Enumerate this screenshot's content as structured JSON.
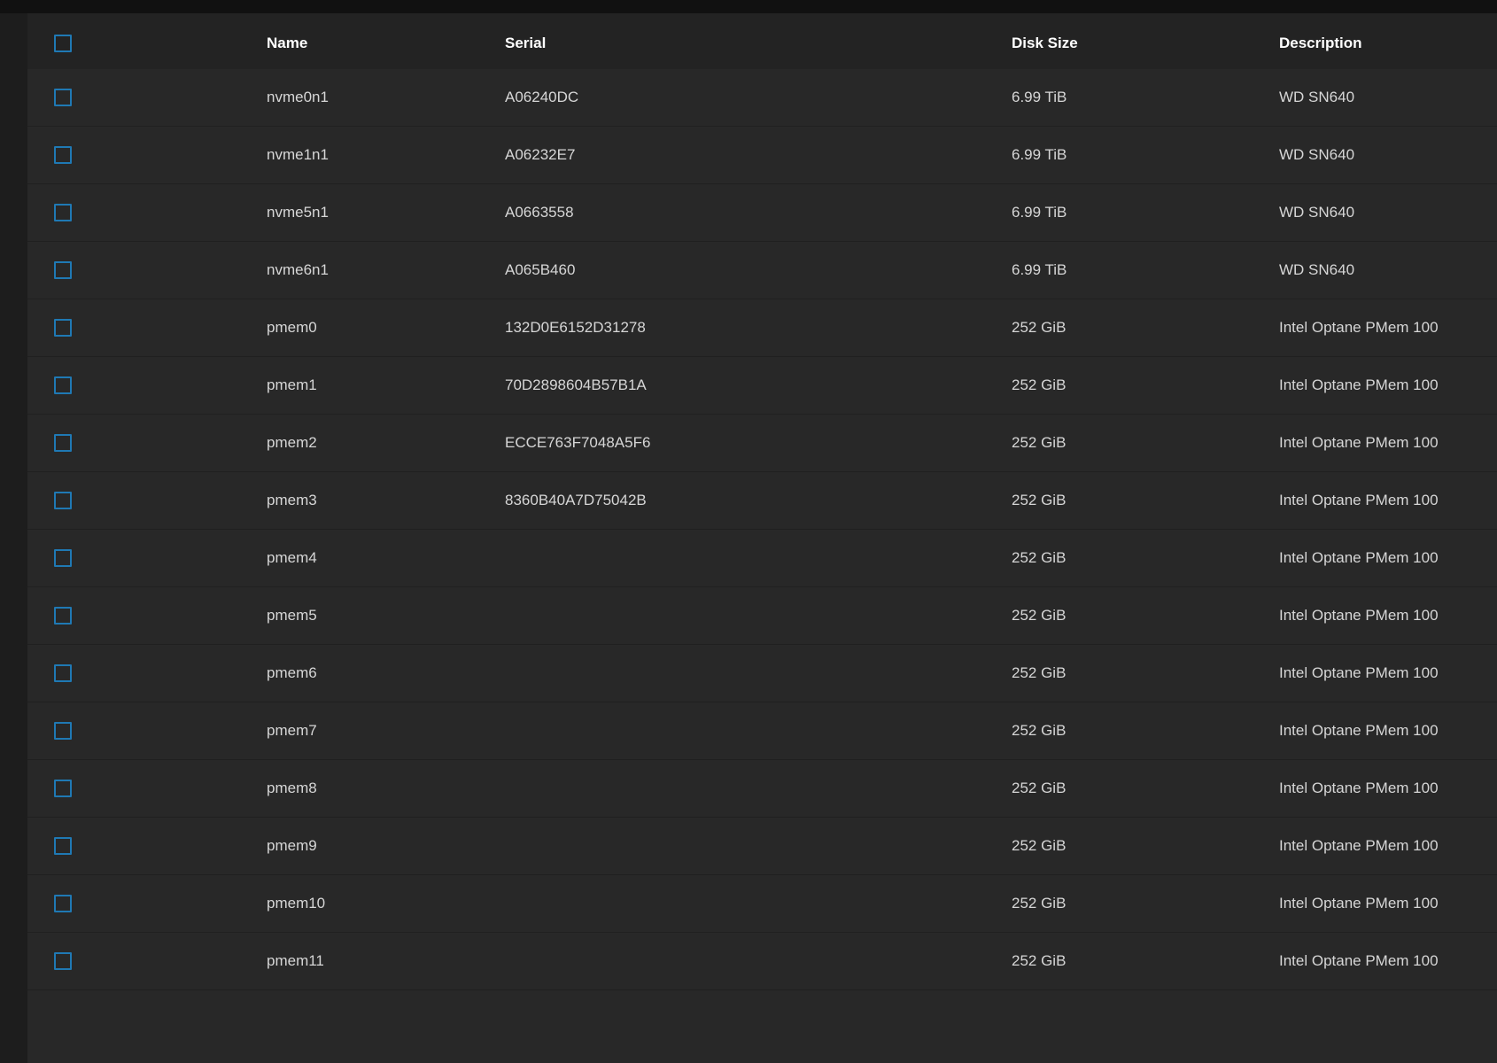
{
  "table": {
    "columns": {
      "name": "Name",
      "serial": "Serial",
      "disk_size": "Disk Size",
      "description": "Description"
    },
    "rows": [
      {
        "name": "nvme0n1",
        "serial": "A06240DC",
        "disk_size": "6.99 TiB",
        "description": "WD SN640"
      },
      {
        "name": "nvme1n1",
        "serial": "A06232E7",
        "disk_size": "6.99 TiB",
        "description": "WD SN640"
      },
      {
        "name": "nvme5n1",
        "serial": "A0663558",
        "disk_size": "6.99 TiB",
        "description": "WD SN640"
      },
      {
        "name": "nvme6n1",
        "serial": "A065B460",
        "disk_size": "6.99 TiB",
        "description": "WD SN640"
      },
      {
        "name": "pmem0",
        "serial": "132D0E6152D31278",
        "disk_size": "252 GiB",
        "description": "Intel Optane PMem 100"
      },
      {
        "name": "pmem1",
        "serial": "70D2898604B57B1A",
        "disk_size": "252 GiB",
        "description": "Intel Optane PMem 100"
      },
      {
        "name": "pmem2",
        "serial": "ECCE763F7048A5F6",
        "disk_size": "252 GiB",
        "description": "Intel Optane PMem 100"
      },
      {
        "name": "pmem3",
        "serial": "8360B40A7D75042B",
        "disk_size": "252 GiB",
        "description": "Intel Optane PMem 100"
      },
      {
        "name": "pmem4",
        "serial": "",
        "disk_size": "252 GiB",
        "description": "Intel Optane PMem 100"
      },
      {
        "name": "pmem5",
        "serial": "",
        "disk_size": "252 GiB",
        "description": "Intel Optane PMem 100"
      },
      {
        "name": "pmem6",
        "serial": "",
        "disk_size": "252 GiB",
        "description": "Intel Optane PMem 100"
      },
      {
        "name": "pmem7",
        "serial": "",
        "disk_size": "252 GiB",
        "description": "Intel Optane PMem 100"
      },
      {
        "name": "pmem8",
        "serial": "",
        "disk_size": "252 GiB",
        "description": "Intel Optane PMem 100"
      },
      {
        "name": "pmem9",
        "serial": "",
        "disk_size": "252 GiB",
        "description": "Intel Optane PMem 100"
      },
      {
        "name": "pmem10",
        "serial": "",
        "disk_size": "252 GiB",
        "description": "Intel Optane PMem 100"
      },
      {
        "name": "pmem11",
        "serial": "",
        "disk_size": "252 GiB",
        "description": "Intel Optane PMem 100"
      }
    ]
  },
  "colors": {
    "checkbox_accent": "#1f79b4",
    "row_background": "#282828",
    "header_background": "#232323"
  }
}
